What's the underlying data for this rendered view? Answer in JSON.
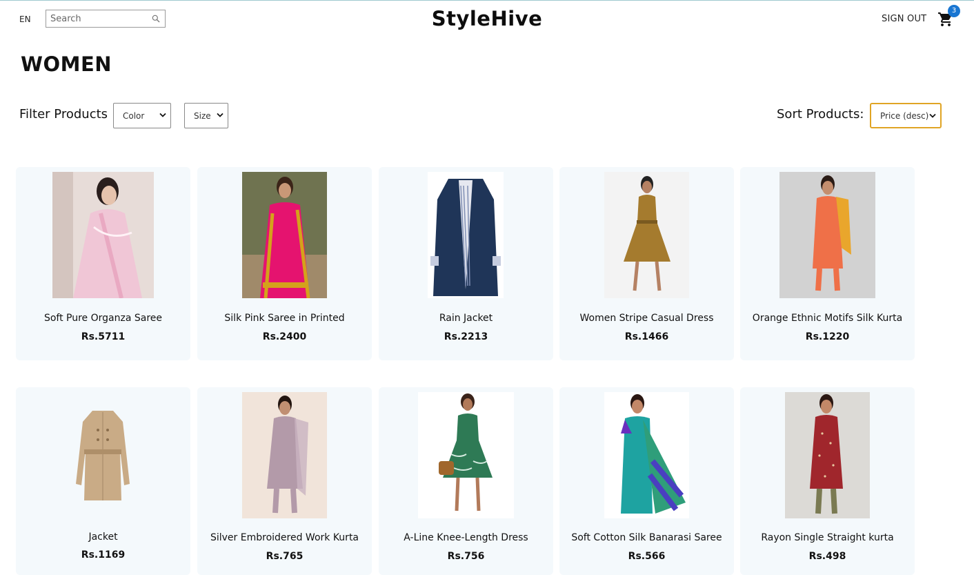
{
  "header": {
    "language": "EN",
    "search_placeholder": "Search",
    "brand": "StyleHive",
    "sign_out": "SIGN OUT",
    "cart_count": "3"
  },
  "page_title": "WOMEN",
  "filters": {
    "label": "Filter Products",
    "color": "Color",
    "size": "Size"
  },
  "sort": {
    "label": "Sort Products:",
    "selected": "Price (desc)"
  },
  "products": [
    {
      "name": "Soft Pure Organza Saree",
      "price": "Rs.5711"
    },
    {
      "name": "Silk Pink Saree in Printed",
      "price": "Rs.2400"
    },
    {
      "name": "Rain Jacket",
      "price": "Rs.2213"
    },
    {
      "name": "Women Stripe Casual Dress",
      "price": "Rs.1466"
    },
    {
      "name": "Orange Ethnic Motifs Silk Kurta",
      "price": "Rs.1220"
    },
    {
      "name": "Jacket",
      "price": "Rs.1169"
    },
    {
      "name": "Silver Embroidered Work Kurta",
      "price": "Rs.765"
    },
    {
      "name": "A-Line Knee-Length Dress",
      "price": "Rs.756"
    },
    {
      "name": "Soft Cotton Silk Banarasi Saree",
      "price": "Rs.566"
    },
    {
      "name": "Rayon Single Straight kurta",
      "price": "Rs.498"
    }
  ],
  "colors": {
    "card_bg": "#f4f9fc",
    "badge": "#1976d2",
    "sort_border": "#e0a424"
  }
}
